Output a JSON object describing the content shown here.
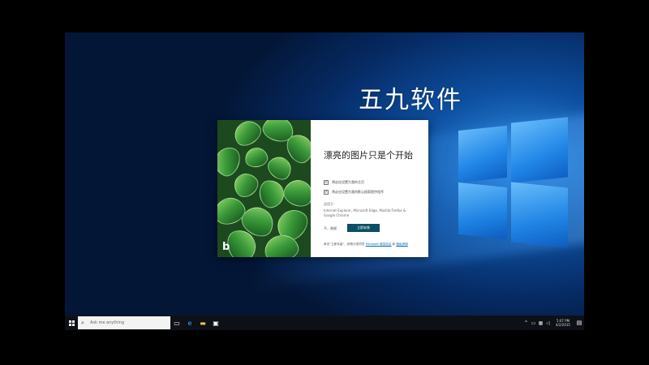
{
  "watermark": "五九软件",
  "dialog": {
    "title": "漂亮的图片只是个开始",
    "option1": "将必应设置为我的主页",
    "option2": "将必应设置为我的默认搜索提供程序",
    "applies_label": "适用于:",
    "browsers": "Internet Explorer, Microsoft Edge, Mozilla Firefox & Google Chrome",
    "skip": "不，谢谢",
    "install": "立即安装",
    "legal_prefix": "单击“立即安装”，即表示您同意",
    "legal_link1": "Microsoft 服务协议",
    "legal_mid": " 和 ",
    "legal_link2": "隐私声明",
    "logo_glyph": "b"
  },
  "taskbar": {
    "search_placeholder": "Ask me anything",
    "time": "5:07 PM",
    "date": "4/2/2015",
    "icons": [
      "windows-start-icon",
      "search-icon",
      "task-view-icon",
      "edge-icon",
      "file-explorer-icon",
      "store-icon",
      "notification-icon"
    ]
  },
  "colors": {
    "install_button": "#0a4f64",
    "link": "#0067b8",
    "taskbar": "#0d1117"
  }
}
